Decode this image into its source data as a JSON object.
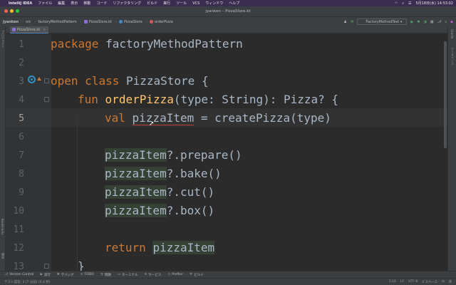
{
  "menubar": {
    "app_name": "IntelliJ IDEA",
    "items": [
      "ファイル",
      "編集",
      "表示",
      "移動",
      "コード",
      "リファクタリング",
      "ビルド",
      "実行",
      "ツール",
      "VCS",
      "ウィンドウ",
      "ヘルプ"
    ],
    "datetime": "5月18日(水) 14:53:02"
  },
  "titlebar": {
    "title": "jyanken – PizzaStore.kt"
  },
  "navbar": {
    "crumbs": [
      "jyanken",
      "src",
      "factoryMethodPattern",
      "PizzaStore.kt",
      "PizzaStore",
      "orderPizza"
    ],
    "run_config": "FactoryMethodTest"
  },
  "tab": {
    "label": "PizzaStore.kt"
  },
  "left_strip": {
    "project_label": "プロジェクト",
    "bookmarks_label": "Bookmarks",
    "structure_label": "構造"
  },
  "right_strip": {
    "gradle_label": "Gradle",
    "db_label": "データベース"
  },
  "code": {
    "line_numbers": [
      "1",
      "2",
      "3",
      "4",
      "5",
      "6",
      "7",
      "8",
      "9",
      "10",
      "11",
      "12",
      "13"
    ],
    "current_line": 5,
    "l1_kw": "package",
    "l1_rest": " factoryMethodPattern",
    "l3_kw1": "open",
    "l3_kw2": "class",
    "l3_rest": " PizzaStore {",
    "l4_kw": "fun",
    "l4_fn": "orderPizza",
    "l4_rest": "(type: String): Pizza? {",
    "l5_kw": "val",
    "l5_var": "pizzaItem",
    "l5_rest": " = createPizza(type)",
    "l7_var": "pizzaItem",
    "l7_rest": "?.prepare()",
    "l8_var": "pizzaItem",
    "l8_rest": "?.bake()",
    "l9_var": "pizzaItem",
    "l9_rest": "?.cut()",
    "l10_var": "pizzaItem",
    "l10_rest": "?.box()",
    "l12_kw": "return",
    "l12_var": "pizzaItem",
    "l13": "}"
  },
  "tool_windows": [
    "Version Control",
    "実行",
    "デバッグ",
    "TODO",
    "問題",
    "ターミナル",
    "サービス",
    "Profiler",
    "ビルド"
  ],
  "status": {
    "message": "テスト成功: 3 (7 分前) (0.4 秒)",
    "position": "5:16",
    "line_sep": "LF",
    "encoding": "UTF-8",
    "indent": "4 スペース"
  },
  "colors": {
    "keyword": "#cc7832",
    "function": "#ffc66d",
    "text": "#a9b7c6",
    "background": "#2b2b2b"
  }
}
